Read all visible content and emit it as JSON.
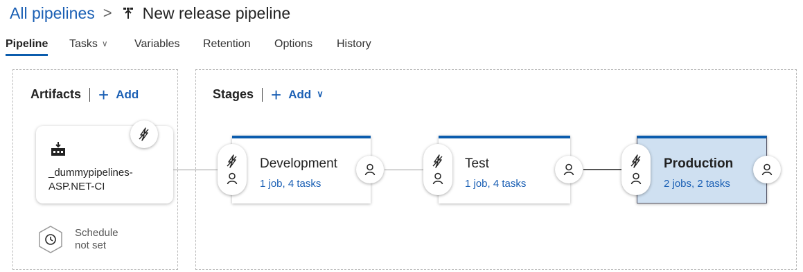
{
  "breadcrumb": {
    "root": "All pipelines",
    "separator": ">",
    "title": "New release pipeline"
  },
  "tabs": [
    {
      "label": "Pipeline",
      "active": true
    },
    {
      "label": "Tasks",
      "has_dropdown": true
    },
    {
      "label": "Variables"
    },
    {
      "label": "Retention"
    },
    {
      "label": "Options"
    },
    {
      "label": "History"
    }
  ],
  "artifacts": {
    "title": "Artifacts",
    "add_label": "Add",
    "card": {
      "name_line1": "_dummypipelines-",
      "name_line2": "ASP.NET-CI",
      "icon": "build-artifact-icon"
    },
    "schedule": {
      "line1": "Schedule",
      "line2": "not set",
      "icon": "clock-icon"
    }
  },
  "stages": {
    "title": "Stages",
    "add_label": "Add",
    "items": [
      {
        "name": "Development",
        "jobs": "1 job, 4 tasks",
        "selected": false
      },
      {
        "name": "Test",
        "jobs": "1 job, 4 tasks",
        "selected": false
      },
      {
        "name": "Production",
        "jobs": "2 jobs, 2 tasks",
        "selected": true
      }
    ]
  },
  "colors": {
    "accent": "#0b5cad",
    "link": "#1a5fb4",
    "selected_stage_bg": "#cfe0f1"
  },
  "icons": {
    "trigger": "lightning-bolt-icon",
    "approver": "person-icon"
  }
}
